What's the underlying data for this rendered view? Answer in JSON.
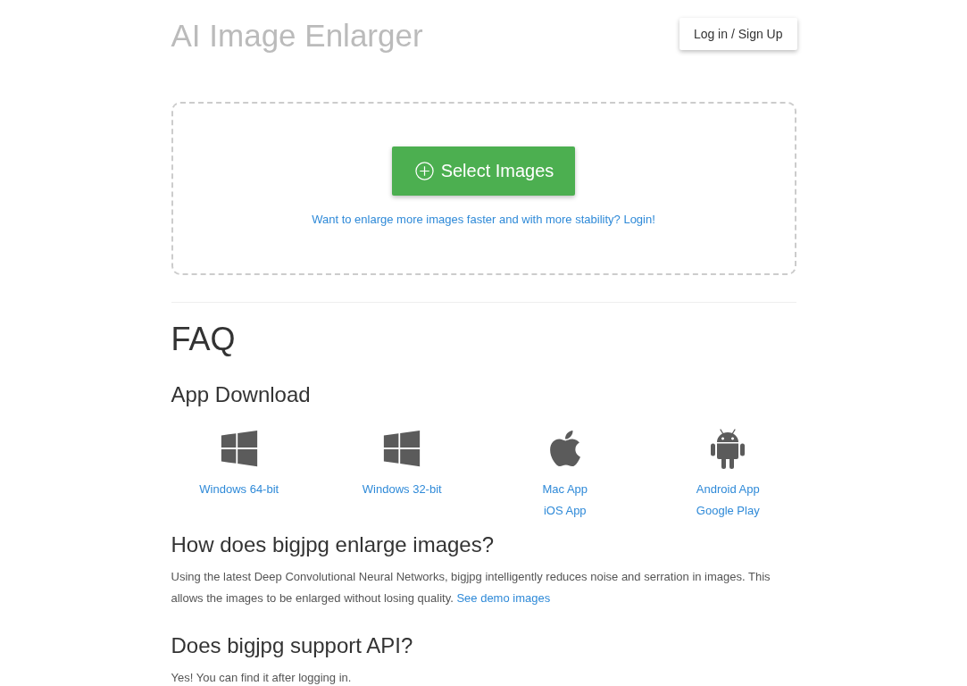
{
  "header": {
    "title": "AI Image Enlarger",
    "login_button": "Log in / Sign Up"
  },
  "upload": {
    "button": "Select Images",
    "login_prompt": "Want to enlarge more images faster and with more stability? Login!"
  },
  "faq": {
    "title": "FAQ",
    "app_download": {
      "heading": "App Download",
      "apps": [
        {
          "kind": "windows",
          "links": [
            "Windows 64-bit"
          ]
        },
        {
          "kind": "windows",
          "links": [
            "Windows 32-bit"
          ]
        },
        {
          "kind": "apple",
          "links": [
            "Mac App",
            "iOS App"
          ]
        },
        {
          "kind": "android",
          "links": [
            "Android App",
            "Google Play"
          ]
        }
      ]
    },
    "questions": [
      {
        "question": "How does bigjpg enlarge images?",
        "answer": "Using the latest Deep Convolutional Neural Networks, bigjpg intelligently reduces noise and serration in images. This allows the images to be enlarged without losing quality.",
        "link": "See demo images"
      },
      {
        "question": "Does bigjpg support API?",
        "answer": "Yes! You can find it after logging in."
      }
    ]
  }
}
